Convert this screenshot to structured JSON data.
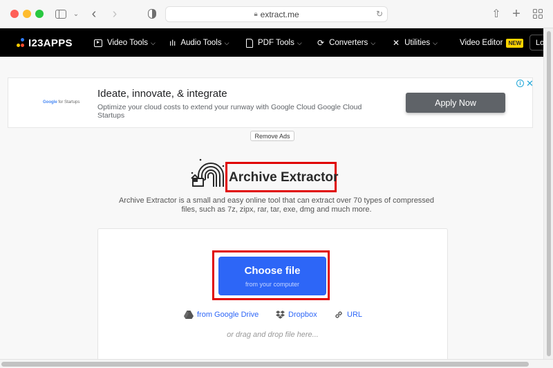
{
  "browser": {
    "url": "extract.me",
    "nav_back_icon": "chevron-left-icon",
    "nav_forward_icon": "chevron-right-icon"
  },
  "sitenav": {
    "logo": "I23APPS",
    "items": [
      {
        "label": "Video Tools",
        "icon": "play-icon"
      },
      {
        "label": "Audio Tools",
        "icon": "waveform-icon"
      },
      {
        "label": "PDF Tools",
        "icon": "document-icon"
      },
      {
        "label": "Converters",
        "icon": "convert-icon"
      },
      {
        "label": "Utilities",
        "icon": "tools-icon"
      }
    ],
    "video_editor": "Video Editor",
    "new_badge": "NEW",
    "login": "Log"
  },
  "ad": {
    "brand": "Google for Startups",
    "brand_g": "Google",
    "brand_rest": " for Startups",
    "title": "Ideate, innovate, & integrate",
    "description": "Optimize your cloud costs to extend your runway with Google Cloud Google Cloud Startups",
    "cta": "Apply Now",
    "info": "i",
    "close": "✕",
    "remove_ads": "Remove Ads"
  },
  "hero": {
    "title": "Archive Extractor",
    "description": "Archive Extractor is a small and easy online tool that can extract over 70 types of compressed files, such as 7z, zipx, rar, tar, exe, dmg and much more."
  },
  "upload": {
    "choose_label": "Choose file",
    "choose_sub": "from your computer",
    "sources": [
      {
        "label": "from Google Drive",
        "icon": "google-drive-icon"
      },
      {
        "label": "Dropbox",
        "icon": "dropbox-icon"
      },
      {
        "label": "URL",
        "icon": "link-icon"
      }
    ],
    "drag_text": "or drag and drop file here..."
  },
  "colors": {
    "accent_blue": "#2d66f7",
    "highlight_red": "#e00000",
    "new_badge": "#ffd400",
    "ad_cta": "#5f6368"
  }
}
